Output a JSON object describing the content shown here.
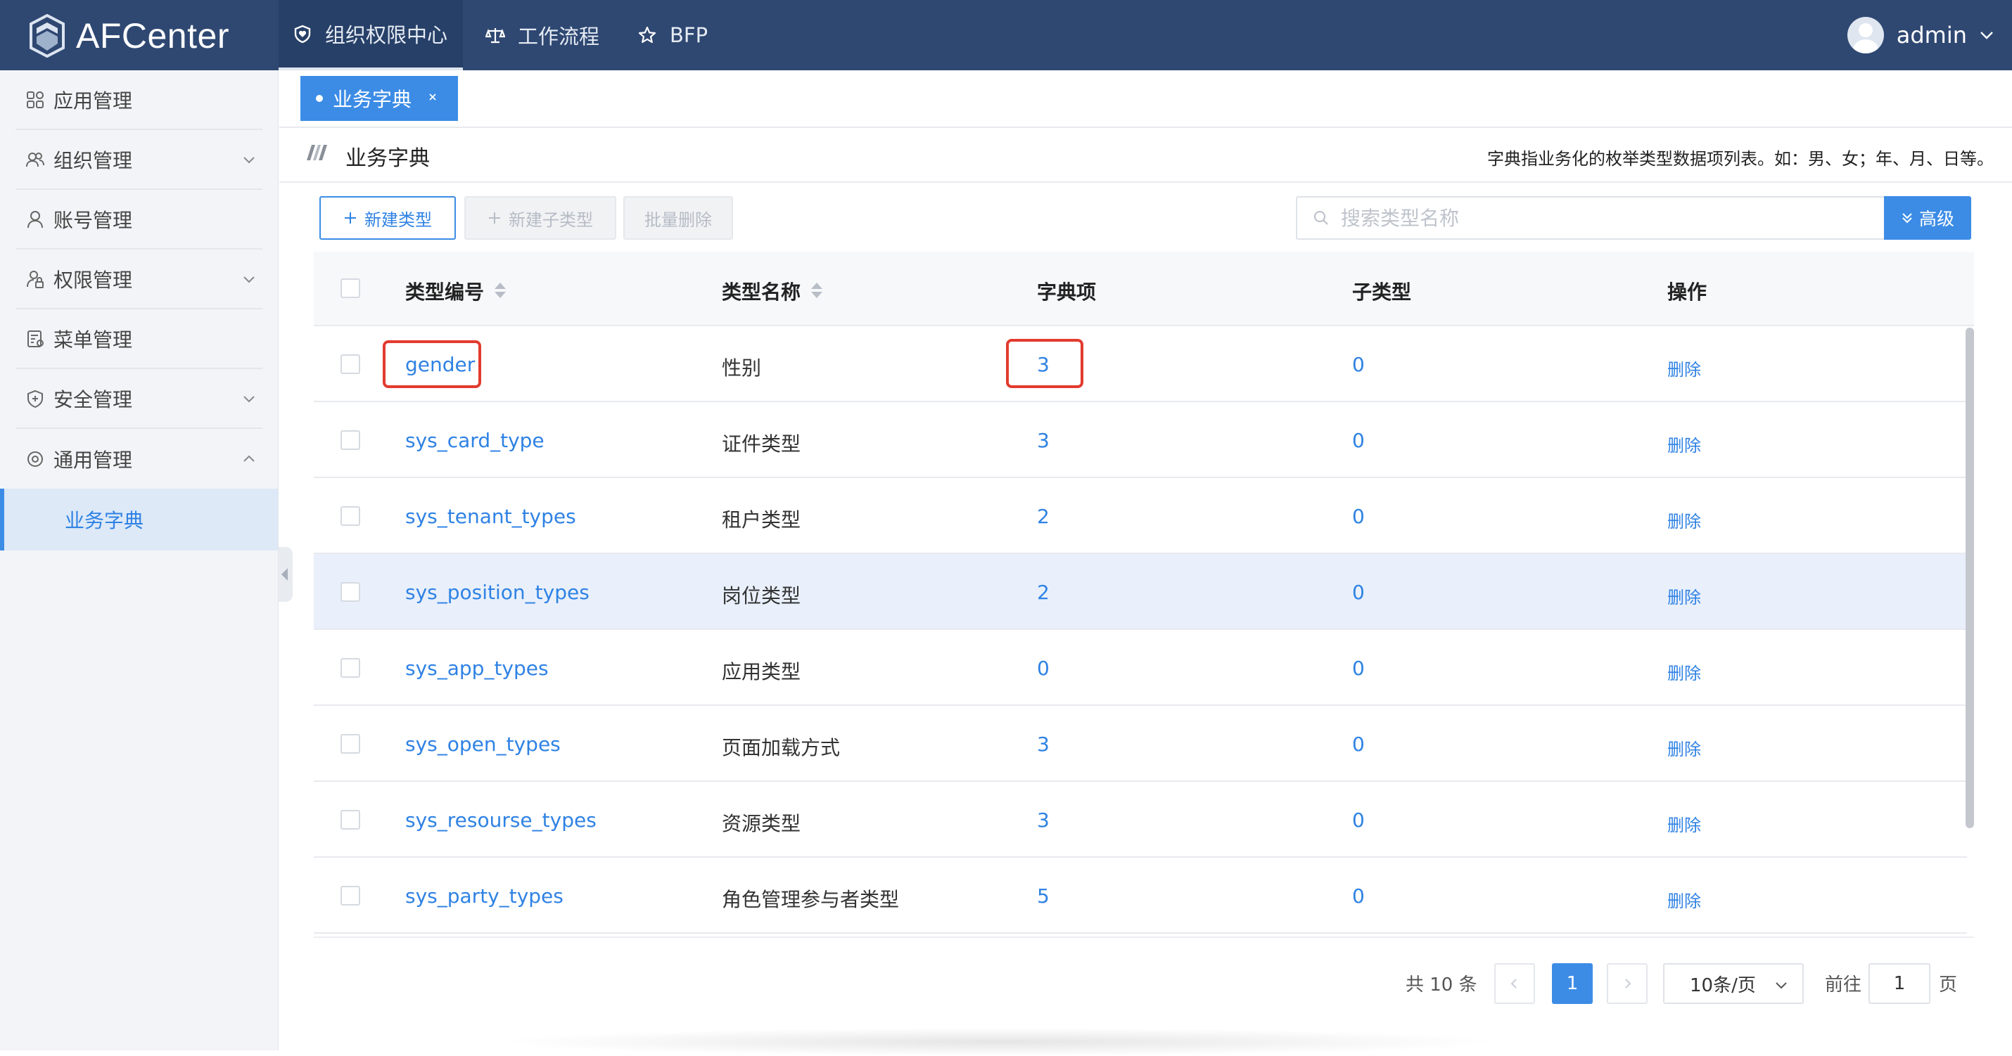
{
  "app": {
    "name": "AFCenter"
  },
  "topnav": [
    {
      "label": "组织权限中心",
      "icon": "heart-shield-icon",
      "active": true
    },
    {
      "label": "工作流程",
      "icon": "balance-icon",
      "active": false
    },
    {
      "label": "BFP",
      "icon": "star-icon",
      "active": false
    }
  ],
  "user": {
    "name": "admin"
  },
  "sidebar": {
    "items": [
      {
        "label": "应用管理",
        "icon": "grid-icon"
      },
      {
        "label": "组织管理",
        "icon": "users-icon",
        "expandable": true
      },
      {
        "label": "账号管理",
        "icon": "user-icon"
      },
      {
        "label": "权限管理",
        "icon": "user-lock-icon",
        "expandable": true
      },
      {
        "label": "菜单管理",
        "icon": "menu-doc-icon"
      },
      {
        "label": "安全管理",
        "icon": "shield-plus-icon",
        "expandable": true
      },
      {
        "label": "通用管理",
        "icon": "settings-icon",
        "expanded": true
      }
    ],
    "sub_active": "业务字典"
  },
  "tabs": [
    {
      "label": "业务字典"
    }
  ],
  "page": {
    "title": "业务字典",
    "description": "字典指业务化的枚举类型数据项列表。如：男、女；年、月、日等。"
  },
  "toolbar": {
    "new_type": "新建类型",
    "new_subtype": "新建子类型",
    "batch_delete": "批量删除",
    "search_placeholder": "搜索类型名称",
    "advanced": "高级"
  },
  "table": {
    "columns": [
      "类型编号",
      "类型名称",
      "字典项",
      "子类型",
      "操作"
    ],
    "rows": [
      {
        "code": "gender",
        "name": "性别",
        "items": "3",
        "subs": "0",
        "op": "删除"
      },
      {
        "code": "sys_card_type",
        "name": "证件类型",
        "items": "3",
        "subs": "0",
        "op": "删除"
      },
      {
        "code": "sys_tenant_types",
        "name": "租户类型",
        "items": "2",
        "subs": "0",
        "op": "删除"
      },
      {
        "code": "sys_position_types",
        "name": "岗位类型",
        "items": "2",
        "subs": "0",
        "op": "删除"
      },
      {
        "code": "sys_app_types",
        "name": "应用类型",
        "items": "0",
        "subs": "0",
        "op": "删除"
      },
      {
        "code": "sys_open_types",
        "name": "页面加载方式",
        "items": "3",
        "subs": "0",
        "op": "删除"
      },
      {
        "code": "sys_resourse_types",
        "name": "资源类型",
        "items": "3",
        "subs": "0",
        "op": "删除"
      },
      {
        "code": "sys_party_types",
        "name": "角色管理参与者类型",
        "items": "5",
        "subs": "0",
        "op": "删除"
      }
    ]
  },
  "pagination": {
    "total": "共 10 条",
    "current_page": "1",
    "page_size": "10条/页",
    "goto_label": "前往",
    "goto_value": "1",
    "page_unit": "页"
  },
  "colors": {
    "header_bg": "#2f4872",
    "accent": "#3c8ce6",
    "highlight_box": "#e23b2f"
  }
}
